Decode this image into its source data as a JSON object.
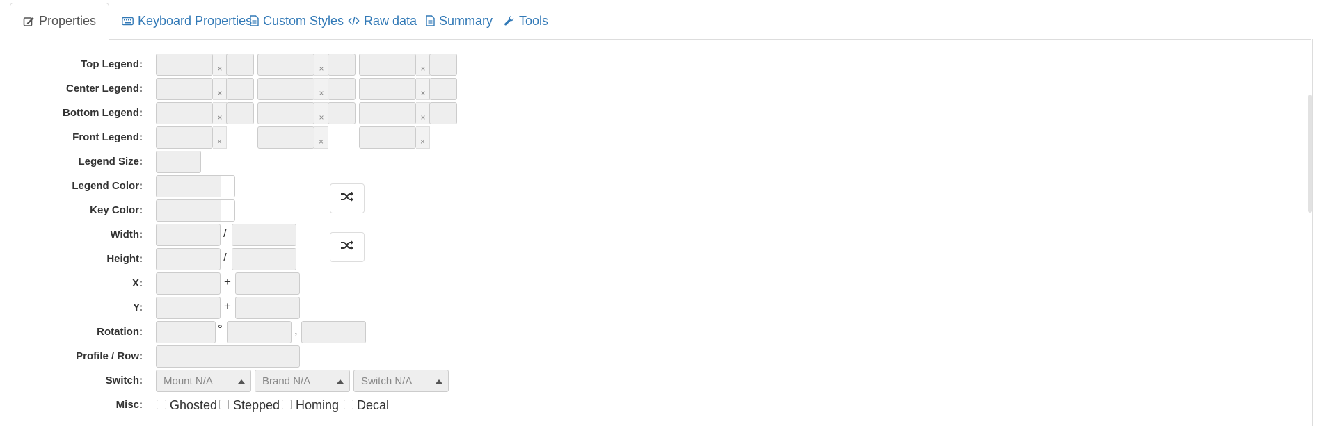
{
  "tabs": [
    {
      "label": "Properties",
      "icon": "edit-icon",
      "active": true
    },
    {
      "label": "Keyboard Properties",
      "icon": "keyboard-icon"
    },
    {
      "label": "Custom Styles",
      "icon": "document-icon"
    },
    {
      "label": "Raw data",
      "icon": "code-icon"
    },
    {
      "label": "Summary",
      "icon": "document-icon"
    },
    {
      "label": "Tools",
      "icon": "wrench-icon"
    }
  ],
  "labels": {
    "top_legend": "Top Legend:",
    "center_legend": "Center Legend:",
    "bottom_legend": "Bottom Legend:",
    "front_legend": "Front Legend:",
    "legend_size": "Legend Size:",
    "legend_color": "Legend Color:",
    "key_color": "Key Color:",
    "width": "Width:",
    "height": "Height:",
    "x": "X:",
    "y": "Y:",
    "rotation": "Rotation:",
    "profile_row": "Profile / Row:",
    "switch": "Switch:",
    "misc": "Misc:"
  },
  "clear_glyph": "×",
  "separators": {
    "slash": "/",
    "plus": "+",
    "degree": "°",
    "comma": ","
  },
  "switch": {
    "mount": "Mount N/A",
    "brand": "Brand N/A",
    "switch": "Switch N/A"
  },
  "misc": {
    "ghosted": "Ghosted",
    "stepped": "Stepped",
    "homing": "Homing",
    "decal": "Decal"
  },
  "colors": {
    "link": "#337ab7",
    "disabled_bg": "#eeeeee",
    "border": "#cccccc"
  }
}
